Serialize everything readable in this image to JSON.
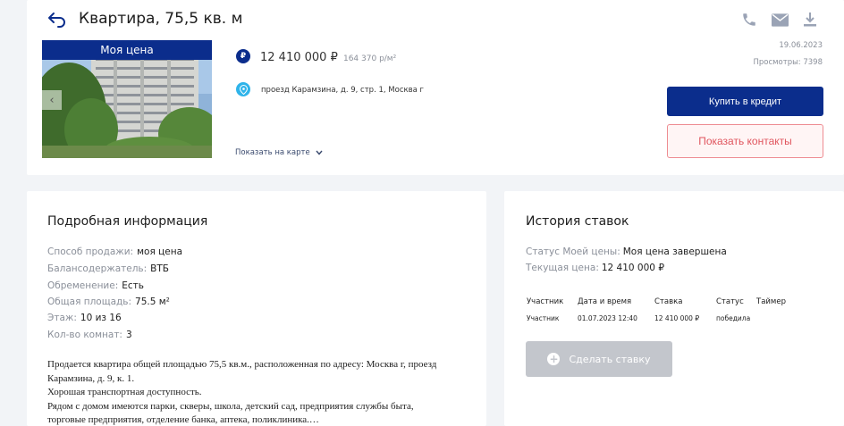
{
  "listing": {
    "title": "Квартира, 75,5 кв. м",
    "photo_banner": "Моя цена",
    "price": "12 410 000 ₽",
    "price_per_sqm": "164 370 р/м²",
    "currency_glyph": "₽",
    "address": "проезд Карамзина, д. 9, стр. 1, Москва г",
    "map_link": "Показать на карте",
    "date": "19.06.2023",
    "views": "Просмотры: 7398",
    "buy_credit": "Купить в кредит",
    "show_contacts": "Показать контакты"
  },
  "icons": {
    "back": "back-arrow-icon",
    "phone": "phone-icon",
    "mail": "mail-icon",
    "download": "download-icon",
    "price": "ruble-icon",
    "location": "location-pin-icon",
    "chevron": "chevron-down-icon",
    "prev": "chevron-left-icon",
    "plus": "plus-icon"
  },
  "details": {
    "title": "Подробная информация",
    "rows": [
      {
        "label": "Способ продажи:",
        "value": "моя цена"
      },
      {
        "label": "Балансодержатель:",
        "value": "ВТБ"
      },
      {
        "label": "Обременение:",
        "value": "Есть"
      },
      {
        "label": "Общая площадь:",
        "value": "75.5 м²"
      },
      {
        "label": "Этаж:",
        "value": "10 из 16"
      },
      {
        "label": "Кол-во комнат:",
        "value": "3"
      }
    ],
    "description_lines": [
      "Продается квартира общей площадью 75,5 кв.м., расположенная по адресу: Москва г, проезд",
      "Карамзина, д. 9, к. 1.",
      "Хорошая транспортная доступность.",
      "Рядом с домом имеются парки, скверы, школа, детский сад, предприятия службы быта,",
      "торговые предприятия, отделение банка, аптека, поликлиника.…"
    ]
  },
  "history": {
    "title": "История ставок",
    "status_label": "Статус Моей цены:",
    "status_value": "Моя цена завершена",
    "current_label": "Текущая цена:",
    "current_value": "12 410 000 ₽",
    "columns": [
      "Участник",
      "Дата и время",
      "Ставка",
      "Статус",
      "Таймер"
    ],
    "rows": [
      [
        "Участник",
        "01.07.2023 12:40",
        "12 410 000 ₽",
        "победила",
        ""
      ]
    ],
    "bid_button": "Сделать ставку"
  },
  "colors": {
    "brand_navy": "#0b2d8c",
    "accent_cyan": "#2fb4ea",
    "contacts_red": "#e0555e",
    "disabled_gray": "#c3c6cc",
    "icon_gray": "#9aa3b5"
  }
}
